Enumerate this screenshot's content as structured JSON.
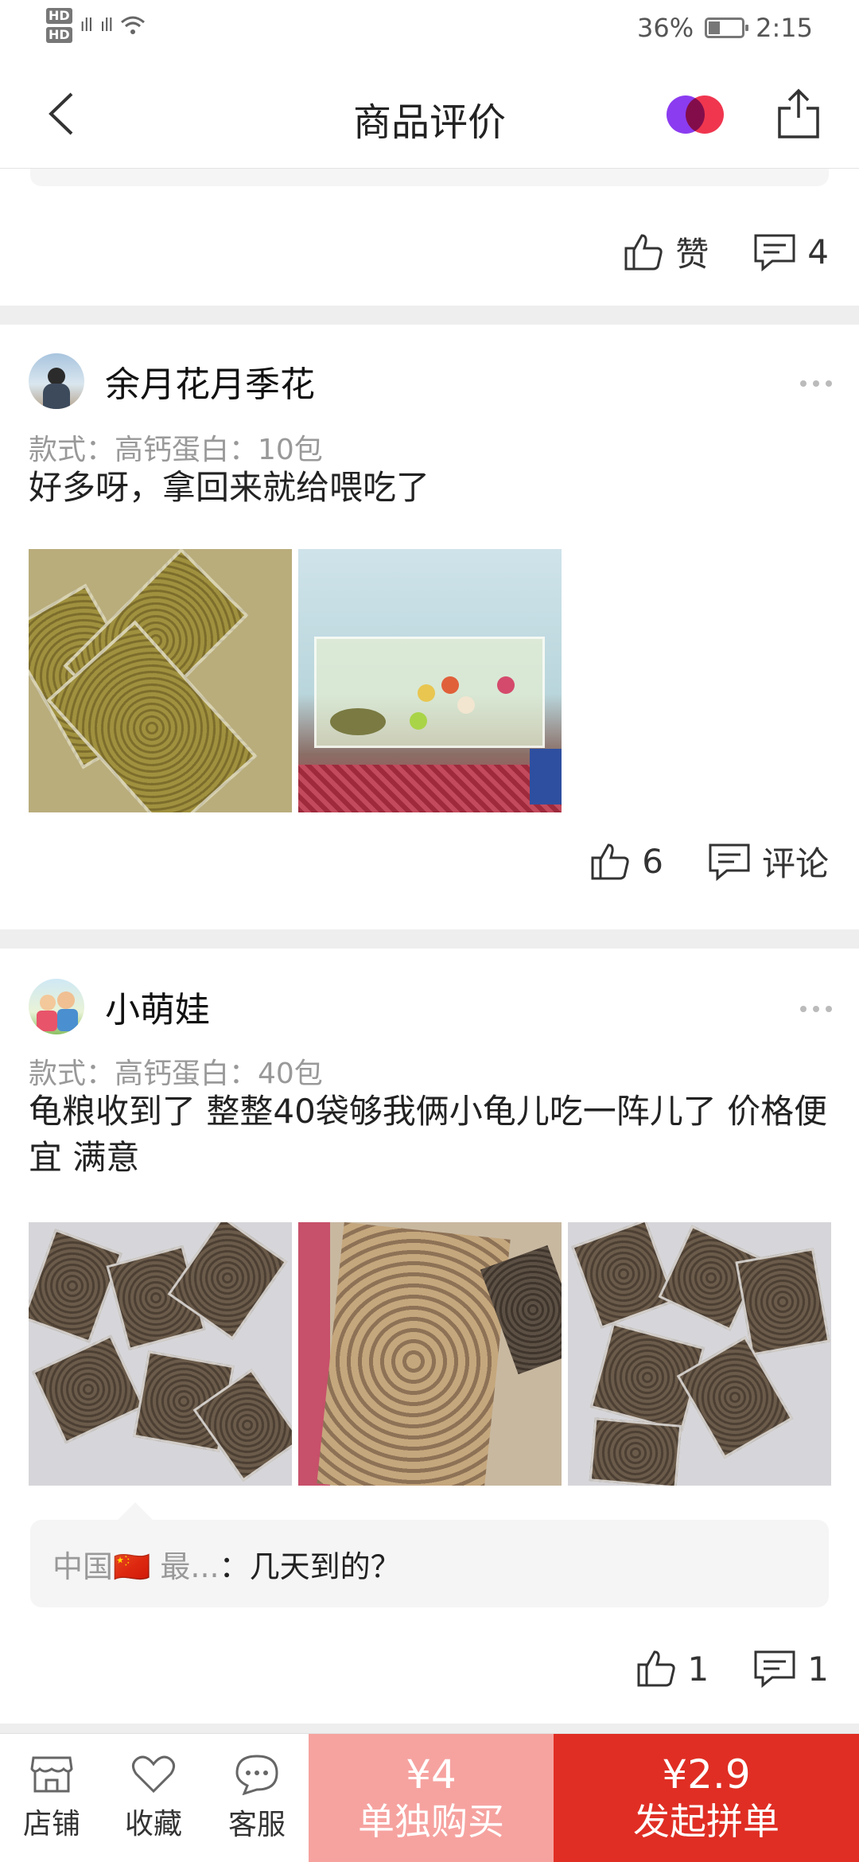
{
  "status_bar": {
    "battery": "36%",
    "time": "2:15",
    "network": "4G"
  },
  "header": {
    "title": "商品评价"
  },
  "top_card": {
    "like_label": "赞",
    "comment_count": "4"
  },
  "reviews": [
    {
      "user": "余月花月季花",
      "spec": "款式：高钙蛋白：10包",
      "text": "好多呀，拿回来就给喂吃了",
      "likes": "6",
      "comment_label": "评论"
    },
    {
      "user": "小萌娃",
      "spec": "款式：高钙蛋白：40包",
      "text": "龟粮收到了 整整40袋够我俩小龟儿吃一阵儿了 价格便宜 满意",
      "reply_user": "中国🇨🇳 最...",
      "reply_sep": "：",
      "reply_text": "几天到的？",
      "likes": "1",
      "comments": "1"
    }
  ],
  "bottom_bar": {
    "store": "店铺",
    "favorite": "收藏",
    "service": "客服",
    "single_price": "¥4",
    "single_label": "单独购买",
    "group_price": "¥2.9",
    "group_label": "发起拼单"
  },
  "colors": {
    "accent": "#e02e24",
    "single_btn": "#f6a3a0"
  }
}
